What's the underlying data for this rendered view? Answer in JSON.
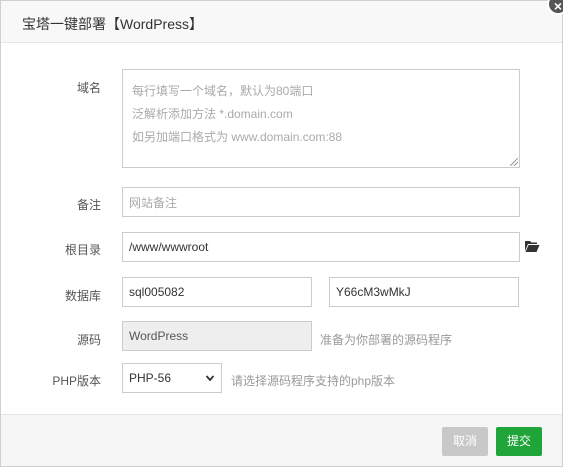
{
  "dialog": {
    "title": "宝塔一键部署【WordPress】",
    "close_glyph": "×"
  },
  "form": {
    "domain": {
      "label": "域名",
      "placeholder_lines": [
        "每行填写一个域名，默认为80端口",
        "泛解析添加方法 *.domain.com",
        "如另加端口格式为 www.domain.com:88"
      ]
    },
    "remark": {
      "label": "备注",
      "placeholder": "网站备注"
    },
    "root_dir": {
      "label": "根目录",
      "value": "/www/wwwroot",
      "icon": "folder-open-icon"
    },
    "database": {
      "label": "数据库",
      "user": "sql005082",
      "password": "Y66cM3wMkJ"
    },
    "source": {
      "label": "源码",
      "value": "WordPress",
      "help": "准备为你部署的源码程序"
    },
    "php_version": {
      "label": "PHP版本",
      "selected": "PHP-56",
      "help": "请选择源码程序支持的php版本"
    }
  },
  "footer": {
    "cancel_label": "取消",
    "submit_label": "提交"
  },
  "colors": {
    "submit": "#20a53a",
    "cancel": "#c8c8c8",
    "folder_icon": "#333333"
  }
}
